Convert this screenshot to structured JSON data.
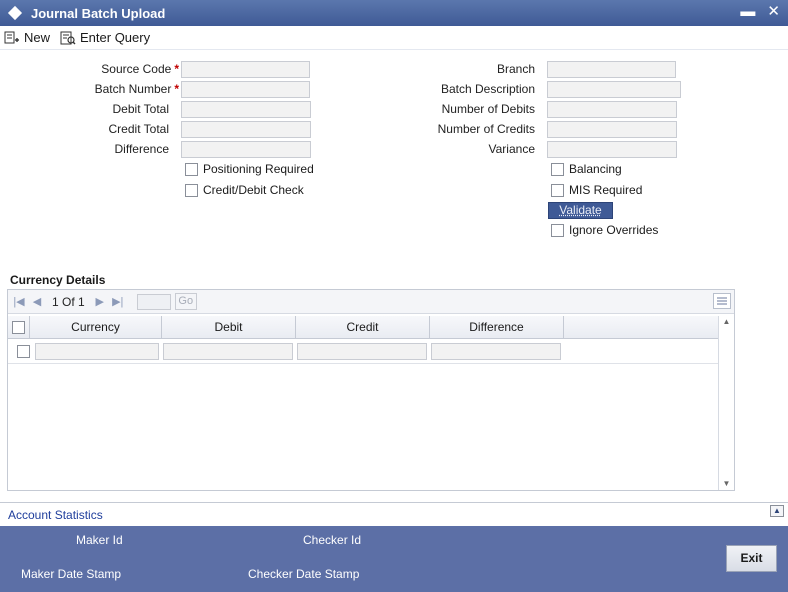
{
  "window": {
    "title": "Journal Batch Upload",
    "minimize": "▬",
    "close": "✕"
  },
  "toolbar": {
    "new_label": "New",
    "enter_query_label": "Enter Query"
  },
  "form": {
    "source_code_label": "Source Code",
    "batch_number_label": "Batch Number",
    "debit_total_label": "Debit Total",
    "credit_total_label": "Credit Total",
    "difference_label": "Difference",
    "required_marker": "*",
    "branch_label": "Branch",
    "batch_description_label": "Batch Description",
    "number_of_debits_label": "Number of Debits",
    "number_of_credits_label": "Number of Credits",
    "variance_label": "Variance",
    "positioning_required_label": "Positioning Required",
    "credit_debit_check_label": "Credit/Debit Check",
    "balancing_label": "Balancing",
    "mis_required_label": "MIS Required",
    "validate_label": "Validate",
    "ignore_overrides_label": "Ignore Overrides"
  },
  "currency_details": {
    "title": "Currency Details",
    "pager": {
      "current": "1",
      "of_label": "Of",
      "total": "1",
      "go_label": "Go"
    },
    "columns": [
      "Currency",
      "Debit",
      "Credit",
      "Difference"
    ]
  },
  "account_statistics": {
    "title": "Account Statistics",
    "maker_id_label": "Maker Id",
    "checker_id_label": "Checker Id",
    "maker_date_stamp_label": "Maker Date Stamp",
    "checker_date_stamp_label": "Checker Date Stamp"
  },
  "footer": {
    "exit_label": "Exit"
  },
  "colors": {
    "titlebar": "#3f5a96",
    "footer": "#5c6fa6",
    "required": "#c00000",
    "link": "#1f3e9c"
  }
}
